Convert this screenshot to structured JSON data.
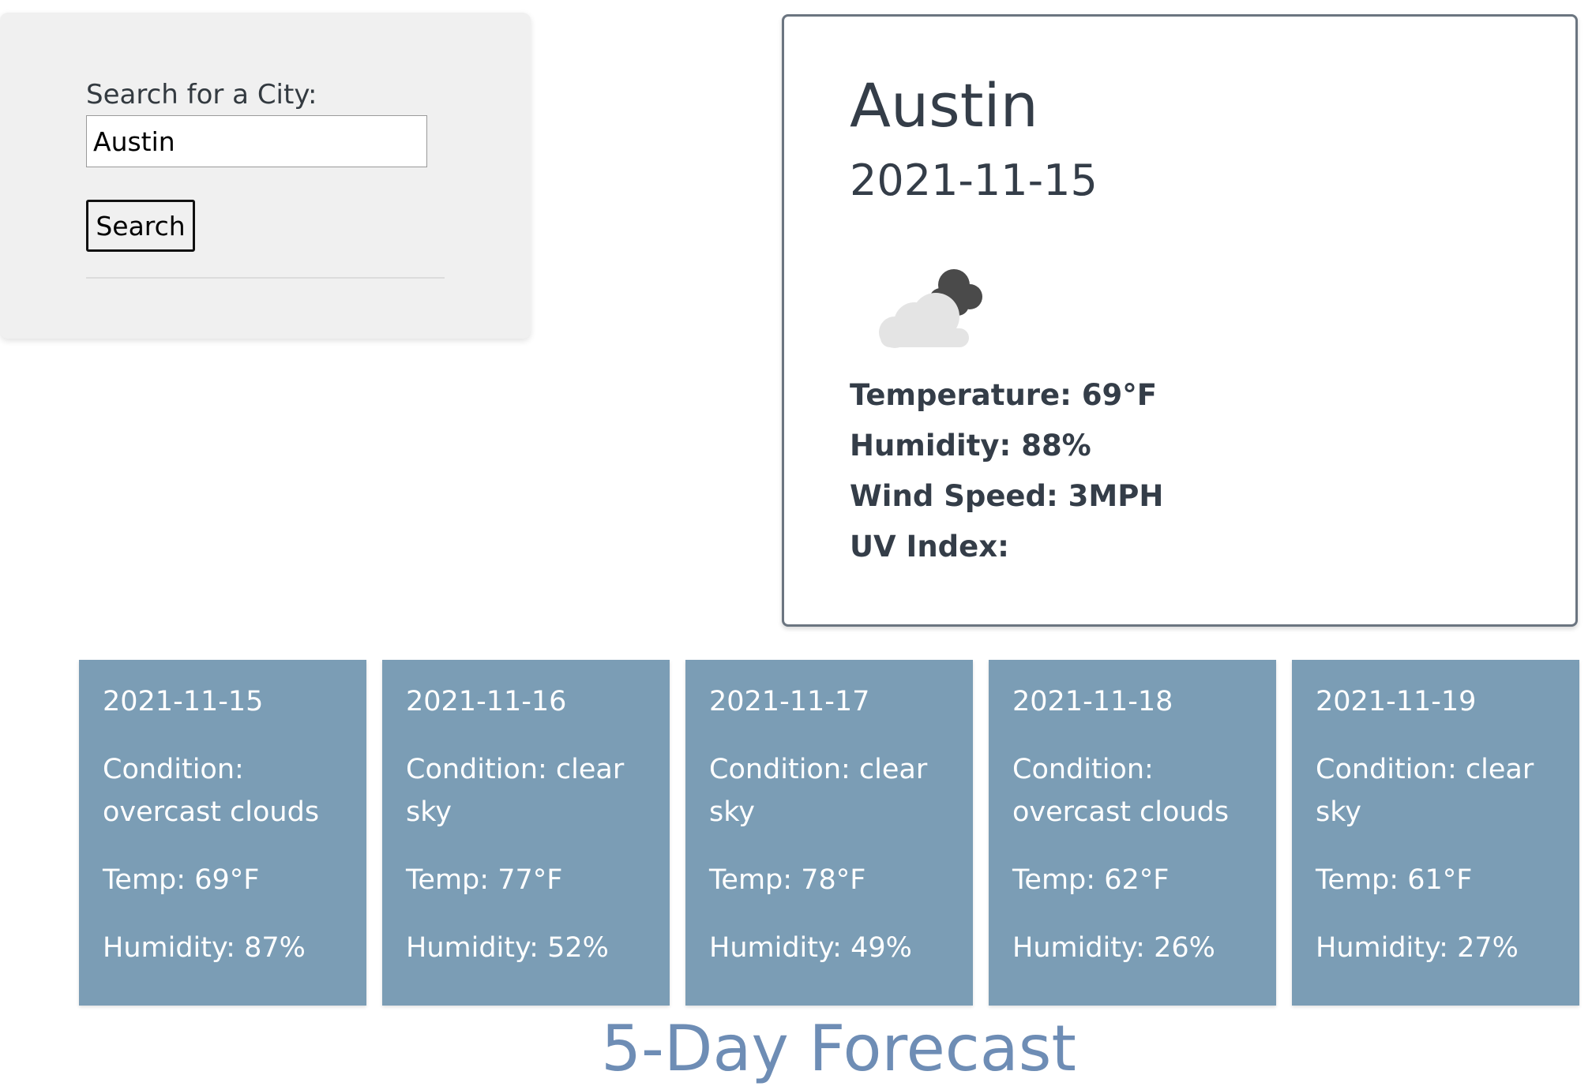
{
  "search": {
    "label": "Search for a City:",
    "input_value": "Austin",
    "button_label": "Search"
  },
  "current": {
    "city": "Austin",
    "date": "2021-11-15",
    "icon": "overcast-clouds-icon",
    "temperature": "Temperature: 69°F",
    "humidity": "Humidity: 88%",
    "wind_speed": "Wind Speed: 3MPH",
    "uv_index": "UV Index:"
  },
  "forecast": {
    "title": "5-Day Forecast",
    "days": [
      {
        "date": "2021-11-15",
        "condition": "Condition: overcast clouds",
        "temp": "Temp: 69°F",
        "humidity": "Humidity: 87%"
      },
      {
        "date": "2021-11-16",
        "condition": "Condition: clear sky",
        "temp": "Temp: 77°F",
        "humidity": "Humidity: 52%"
      },
      {
        "date": "2021-11-17",
        "condition": "Condition: clear sky",
        "temp": "Temp: 78°F",
        "humidity": "Humidity: 49%"
      },
      {
        "date": "2021-11-18",
        "condition": "Condition: overcast clouds",
        "temp": "Temp: 62°F",
        "humidity": "Humidity: 26%"
      },
      {
        "date": "2021-11-19",
        "condition": "Condition: clear sky",
        "temp": "Temp: 61°F",
        "humidity": "Humidity: 27%"
      }
    ]
  },
  "colors": {
    "forecast_card_bg": "#7b9db5",
    "forecast_title": "#6e8db5",
    "search_panel_bg": "#f0f0f0",
    "card_border": "#6b7580"
  }
}
